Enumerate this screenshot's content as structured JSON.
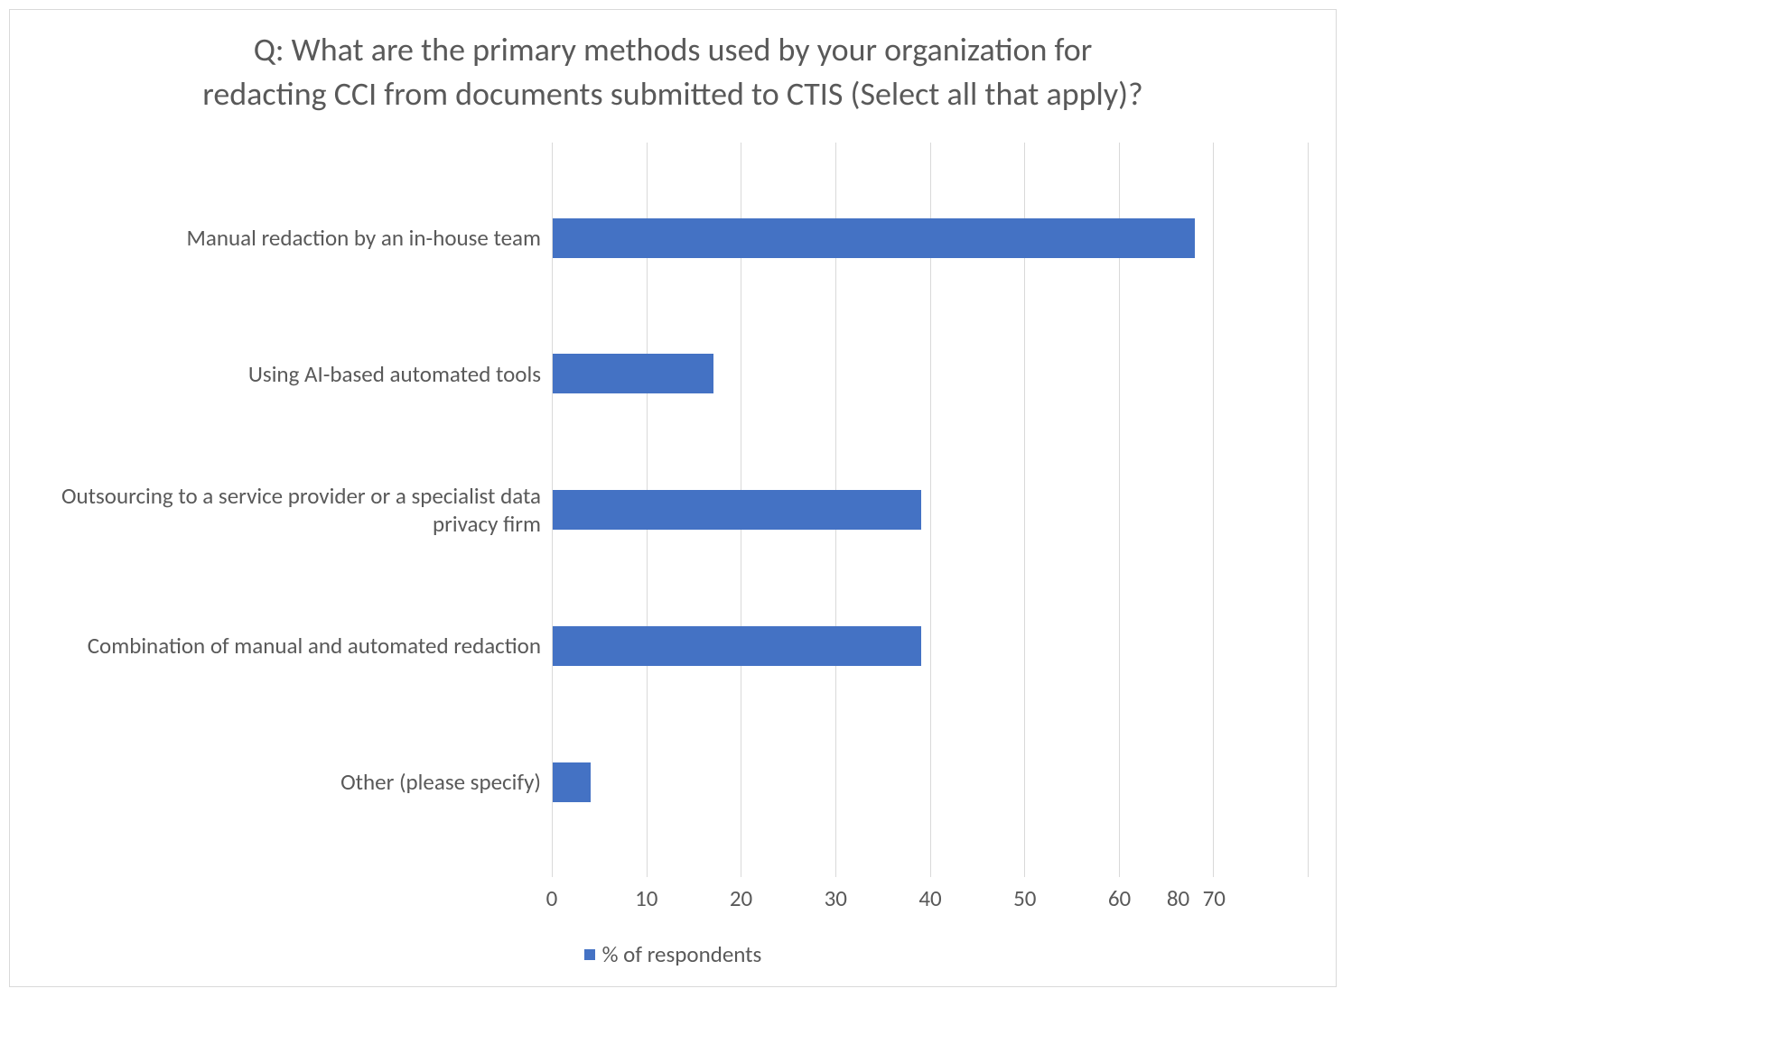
{
  "chart_data": {
    "type": "bar",
    "orientation": "horizontal",
    "title": "Q: What are the primary methods used by your organization for redacting CCI from documents submitted to CTIS (Select all that apply)?",
    "xlabel": "",
    "ylabel": "",
    "xlim": [
      0,
      80
    ],
    "x_ticks": [
      0,
      10,
      20,
      30,
      40,
      50,
      60,
      70,
      80
    ],
    "categories": [
      "Manual redaction by an in-house team",
      "Using AI-based automated tools",
      "Outsourcing to a service provider or a specialist data privacy firm",
      "Combination of manual and automated redaction",
      "Other (please specify)"
    ],
    "series": [
      {
        "name": "% of respondents",
        "values": [
          68,
          17,
          39,
          39,
          4
        ]
      }
    ],
    "legend_position": "bottom",
    "colors": {
      "bar": "#4472c4"
    }
  }
}
